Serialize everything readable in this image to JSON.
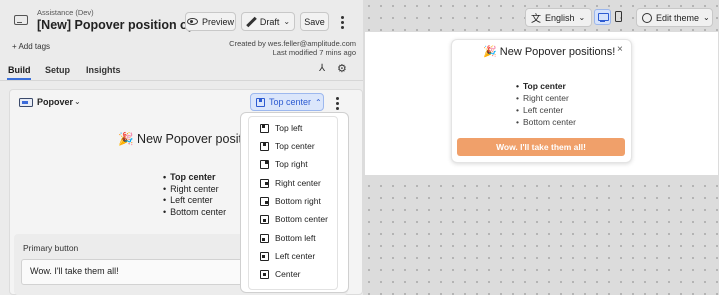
{
  "header": {
    "subtitle": "Assistance (Dev)",
    "title": "[New] Popover position opt...",
    "preview_label": "Preview",
    "status_label": "Draft",
    "save_label": "Save"
  },
  "tags": {
    "add_label": "+ Add tags"
  },
  "meta": {
    "created_by": "Created by wes.feller@amplitude.com",
    "last_modified": "Last modified 7 mins ago"
  },
  "tabs": [
    {
      "label": "Build"
    },
    {
      "label": "Setup"
    },
    {
      "label": "Insights"
    }
  ],
  "editor": {
    "component_label": "Popover",
    "position_selected": "Top center",
    "position_options": [
      {
        "label": "Top left",
        "icon": "position-top-left-icon"
      },
      {
        "label": "Top center",
        "icon": "position-top-center-icon"
      },
      {
        "label": "Top right",
        "icon": "position-top-right-icon"
      },
      {
        "label": "Right center",
        "icon": "position-right-center-icon"
      },
      {
        "label": "Bottom right",
        "icon": "position-bottom-right-icon"
      },
      {
        "label": "Bottom center",
        "icon": "position-bottom-center-icon"
      },
      {
        "label": "Bottom left",
        "icon": "position-bottom-left-icon"
      },
      {
        "label": "Left center",
        "icon": "position-left-center-icon"
      },
      {
        "label": "Center",
        "icon": "position-center-icon"
      }
    ],
    "primary_button_label": "Primary button",
    "primary_button_value": "Wow. I'll take them all!"
  },
  "content": {
    "title": "🎉 New Popover positions!",
    "bullets": [
      "Top center",
      "Right center",
      "Left center",
      "Bottom center"
    ]
  },
  "preview": {
    "language": "English",
    "theme_label": "Edit theme",
    "close_symbol": "×",
    "cta_label": "Wow. I'll take them all!"
  },
  "colors": {
    "accent": "#3a6fd9",
    "cta": "#f0a06a"
  }
}
